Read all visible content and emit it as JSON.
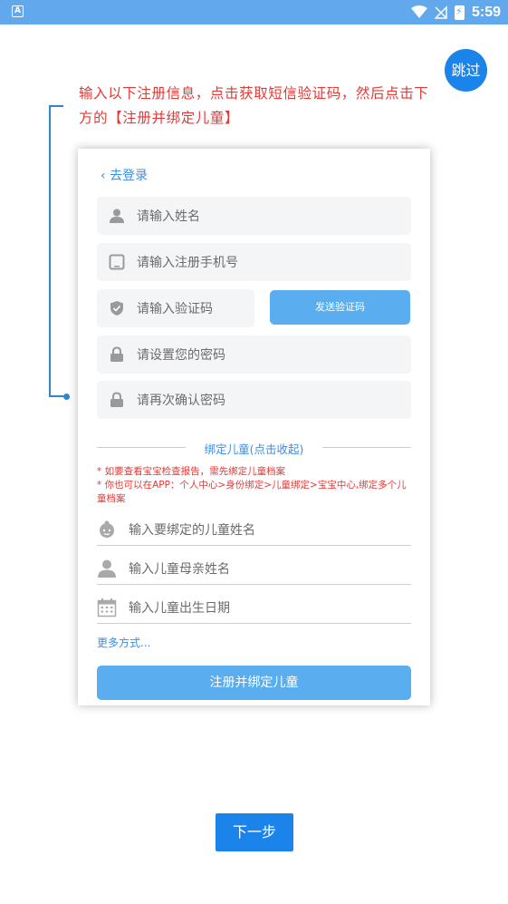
{
  "status_bar": {
    "time": "5:59",
    "app_icon_letter": "A"
  },
  "skip_label": "跳过",
  "instruction": "输入以下注册信息，点击获取短信验证码，然后点击下方的【注册并绑定儿童】",
  "form": {
    "back_label": "去登录",
    "name_placeholder": "请输入姓名",
    "phone_placeholder": "请输入注册手机号",
    "code_placeholder": "请输入验证码",
    "send_code_label": "发送验证码",
    "password_placeholder": "请设置您的密码",
    "confirm_placeholder": "请再次确认密码",
    "bind_section_title": "绑定儿童(点击收起)",
    "note_1": "* 如要查看宝宝检查报告，需先绑定儿童档案",
    "note_2": "* 你也可以在APP：个人中心>身份绑定>儿童绑定>宝宝中心,绑定多个儿童档案",
    "child_name_placeholder": "输入要绑定的儿童姓名",
    "mother_name_placeholder": "输入儿童母亲姓名",
    "birth_date_placeholder": "输入儿童出生日期",
    "more_methods_label": "更多方式...",
    "register_label": "注册并绑定儿童"
  },
  "next_label": "下一步",
  "colors": {
    "accent": "#1a84ea",
    "button": "#5aaeef",
    "warning": "#e53935"
  }
}
